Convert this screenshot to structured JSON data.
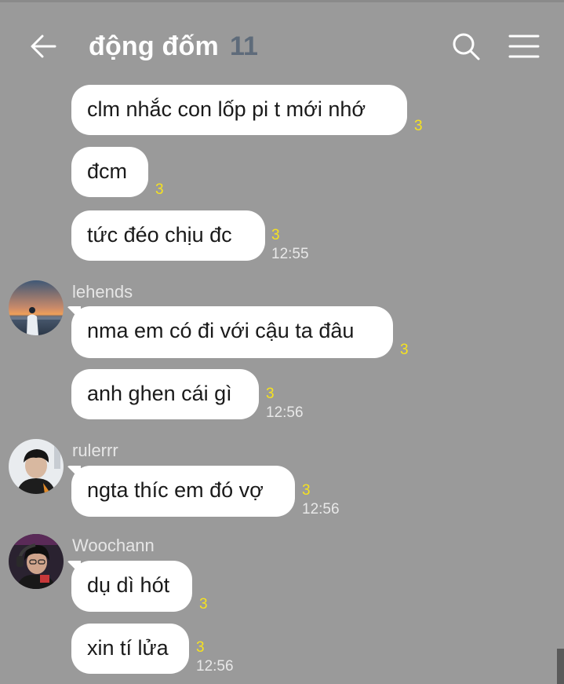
{
  "header": {
    "title": "động đốm",
    "member_count": "11",
    "back_icon": "arrow-left-icon",
    "search_icon": "search-icon",
    "menu_icon": "hamburger-menu-icon"
  },
  "colors": {
    "background": "#9a9a9a",
    "bubble": "#ffffff",
    "unread": "#f6e21f",
    "count": "#5e6b7a"
  },
  "messages": [
    {
      "text": "clm nhắc con lốp pi t mới nhớ",
      "unread": "3",
      "time": ""
    },
    {
      "text": "đcm",
      "unread": "3",
      "time": ""
    },
    {
      "text": "tức đéo chịu đc",
      "unread": "3",
      "time": "12:55"
    },
    {
      "sender": "lehends",
      "text": "nma em có đi với cậu ta đâu",
      "unread": "3",
      "time": ""
    },
    {
      "text": "anh ghen cái gì",
      "unread": "3",
      "time": "12:56"
    },
    {
      "sender": "rulerrr",
      "text": "ngta thíc em đó vợ",
      "unread": "3",
      "time": "12:56"
    },
    {
      "sender": "Woochann",
      "text": "dụ dì hót",
      "unread": "3",
      "time": ""
    },
    {
      "text": "xin tí lửa",
      "unread": "3",
      "time": "12:56"
    }
  ]
}
